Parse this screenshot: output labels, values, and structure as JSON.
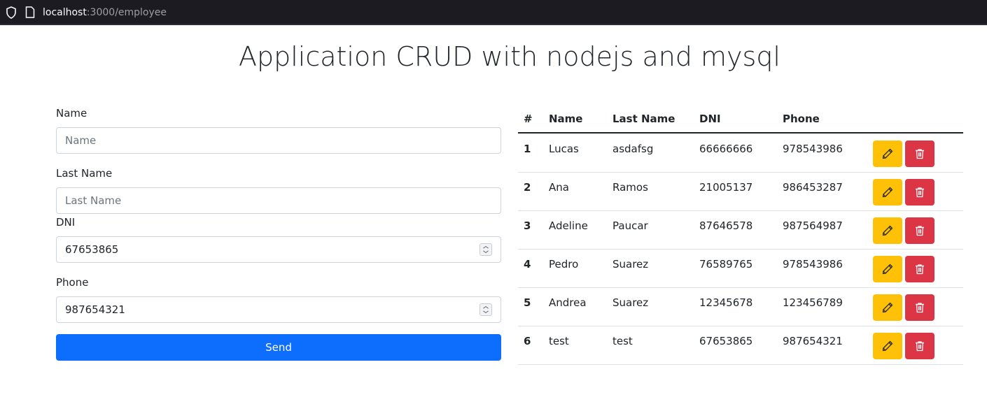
{
  "browser": {
    "url_host": "localhost",
    "url_rest": ":3000/employee"
  },
  "page": {
    "title": "Application CRUD with nodejs and mysql"
  },
  "form": {
    "name_label": "Name",
    "name_placeholder": "Name",
    "lastname_label": "Last Name",
    "lastname_placeholder": "Last Name",
    "dni_label": "DNI",
    "dni_value": "67653865",
    "phone_label": "Phone",
    "phone_value": "987654321",
    "send_label": "Send"
  },
  "table": {
    "headers": [
      "#",
      "Name",
      "Last Name",
      "DNI",
      "Phone"
    ],
    "rows": [
      {
        "id": "1",
        "name": "Lucas",
        "last_name": "asdafsg",
        "dni": "66666666",
        "phone": "978543986"
      },
      {
        "id": "2",
        "name": "Ana",
        "last_name": "Ramos",
        "dni": "21005137",
        "phone": "986453287"
      },
      {
        "id": "3",
        "name": "Adeline",
        "last_name": "Paucar",
        "dni": "87646578",
        "phone": "987564987"
      },
      {
        "id": "4",
        "name": "Pedro",
        "last_name": "Suarez",
        "dni": "76589765",
        "phone": "978543986"
      },
      {
        "id": "5",
        "name": "Andrea",
        "last_name": "Suarez",
        "dni": "12345678",
        "phone": "123456789"
      },
      {
        "id": "6",
        "name": "test",
        "last_name": "test",
        "dni": "67653865",
        "phone": "987654321"
      }
    ]
  },
  "icons": {
    "edit": "pencil-icon",
    "delete": "trash-icon"
  },
  "colors": {
    "primary": "#0d6efd",
    "warning": "#ffc107",
    "danger": "#dc3545"
  }
}
